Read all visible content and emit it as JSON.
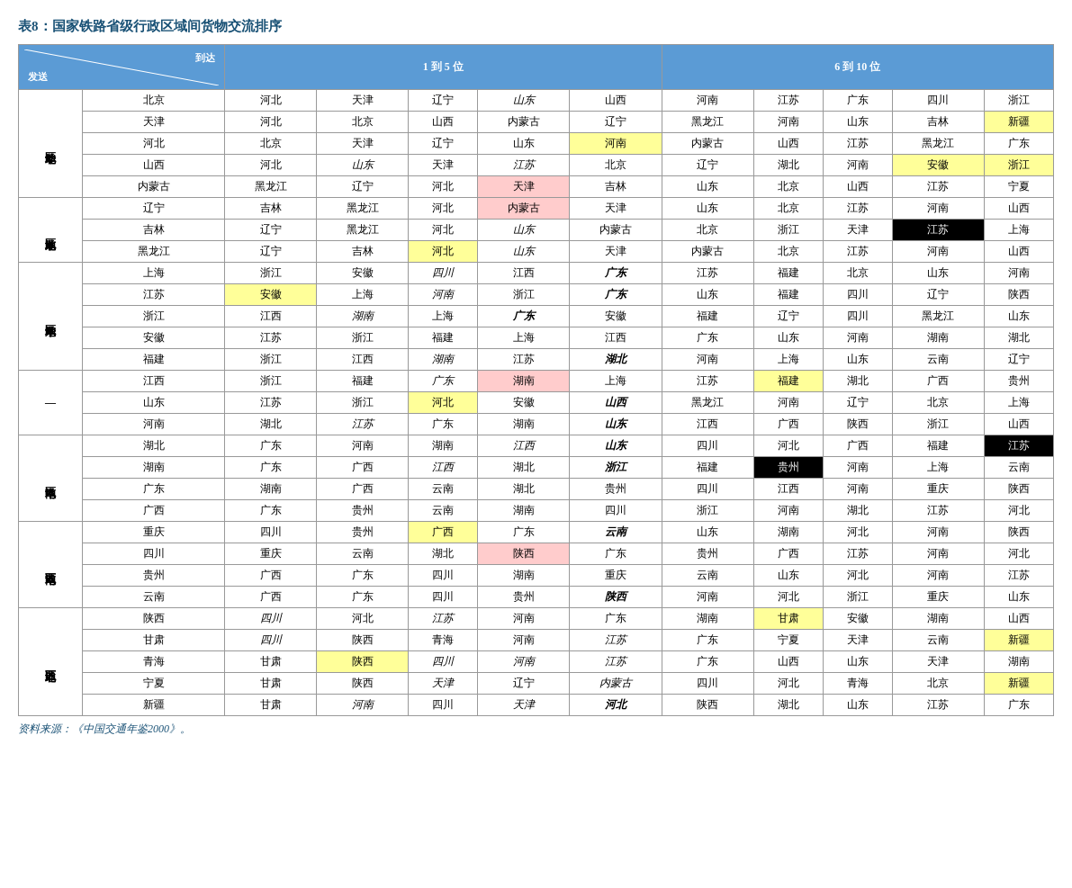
{
  "title": "表8：国家铁路省级行政区域间货物交流排序",
  "source": "资料来源：《中国交通年鉴2000》。",
  "header": {
    "diagonal_to": "到达",
    "diagonal_from": "发送",
    "col1_label": "1 到 5 位",
    "col2_label": "6 到 10 位"
  },
  "rows": [
    {
      "region": "华北地区",
      "city": "北京",
      "c1": "河北",
      "c2": "天津",
      "c3": "辽宁",
      "c4": "山东",
      "c5": "山西",
      "c6": "河南",
      "c7": "江苏",
      "c8": "广东",
      "c9": "四川",
      "c10": "浙江",
      "c3_style": "plain",
      "c4_style": "italic",
      "c5_style": "plain"
    },
    {
      "region": "",
      "city": "天津",
      "c1": "河北",
      "c2": "北京",
      "c3": "山西",
      "c4": "内蒙古",
      "c5": "辽宁",
      "c6": "黑龙江",
      "c7": "河南",
      "c8": "山东",
      "c9": "吉林",
      "c10": "新疆",
      "c3_style": "plain",
      "c4_style": "plain",
      "c10_style": "yellow"
    },
    {
      "region": "",
      "city": "河北",
      "c1": "北京",
      "c2": "天津",
      "c3": "辽宁",
      "c4": "山东",
      "c5": "河南",
      "c6": "内蒙古",
      "c7": "山西",
      "c8": "江苏",
      "c9": "黑龙江",
      "c10": "广东",
      "c3_style": "plain",
      "c5_style": "yellow",
      "c8_style": "plain"
    },
    {
      "region": "",
      "city": "山西",
      "c1": "河北",
      "c2": "山东",
      "c3": "天津",
      "c4": "江苏",
      "c5": "北京",
      "c6": "辽宁",
      "c7": "湖北",
      "c8": "河南",
      "c9": "安徽",
      "c10": "浙江",
      "c2_style": "italic",
      "c4_style": "italic",
      "c9_style": "yellow",
      "c10_style": "yellow"
    },
    {
      "region": "",
      "city": "内蒙古",
      "c1": "黑龙江",
      "c2": "辽宁",
      "c3": "河北",
      "c4": "天津",
      "c5": "吉林",
      "c6": "山东",
      "c7": "北京",
      "c8": "山西",
      "c9": "江苏",
      "c10": "宁夏",
      "c4_style": "pink"
    },
    {
      "region": "东北地区",
      "city": "辽宁",
      "c1": "吉林",
      "c2": "黑龙江",
      "c3": "河北",
      "c4": "内蒙古",
      "c5": "天津",
      "c6": "山东",
      "c7": "北京",
      "c8": "江苏",
      "c9": "河南",
      "c10": "山西",
      "c4_style": "pink"
    },
    {
      "region": "",
      "city": "吉林",
      "c1": "辽宁",
      "c2": "黑龙江",
      "c3": "河北",
      "c4": "山东",
      "c5": "内蒙古",
      "c6": "北京",
      "c7": "浙江",
      "c8": "天津",
      "c9": "江苏",
      "c10": "上海",
      "c4_style": "italic",
      "c9_style": "black"
    },
    {
      "region": "",
      "city": "黑龙江",
      "c1": "辽宁",
      "c2": "吉林",
      "c3": "河北",
      "c4": "山东",
      "c5": "天津",
      "c6": "内蒙古",
      "c7": "北京",
      "c8": "江苏",
      "c9": "河南",
      "c10": "山西",
      "c3_style": "yellow",
      "c4_style": "italic"
    },
    {
      "region": "华东地区",
      "city": "上海",
      "c1": "浙江",
      "c2": "安徽",
      "c3": "四川",
      "c4": "江西",
      "c5": "广东",
      "c6": "江苏",
      "c7": "福建",
      "c8": "北京",
      "c9": "山东",
      "c10": "河南",
      "c3_style": "italic",
      "c5_style": "italic-bold"
    },
    {
      "region": "",
      "city": "江苏",
      "c1": "安徽",
      "c2": "上海",
      "c3": "河南",
      "c4": "浙江",
      "c5": "广东",
      "c6": "山东",
      "c7": "福建",
      "c8": "四川",
      "c9": "辽宁",
      "c10": "陕西",
      "c1_style": "yellow",
      "c3_style": "italic",
      "c5_style": "italic-bold"
    },
    {
      "region": "",
      "city": "浙江",
      "c1": "江西",
      "c2": "湖南",
      "c3": "上海",
      "c4": "广东",
      "c5": "安徽",
      "c6": "福建",
      "c7": "辽宁",
      "c8": "四川",
      "c9": "黑龙江",
      "c10": "山东",
      "c2_style": "italic",
      "c4_style": "italic-bold"
    },
    {
      "region": "",
      "city": "安徽",
      "c1": "江苏",
      "c2": "浙江",
      "c3": "福建",
      "c4": "上海",
      "c5": "江西",
      "c6": "广东",
      "c7": "山东",
      "c8": "河南",
      "c9": "湖南",
      "c10": "湖北"
    },
    {
      "region": "",
      "city": "福建",
      "c1": "浙江",
      "c2": "江西",
      "c3": "湖南",
      "c4": "江苏",
      "c5": "湖北",
      "c6": "河南",
      "c7": "上海",
      "c8": "山东",
      "c9": "云南",
      "c10": "辽宁",
      "c3_style": "italic",
      "c5_style": "italic-bold"
    },
    {
      "region": "—",
      "city": "江西",
      "c1": "浙江",
      "c2": "福建",
      "c3": "广东",
      "c4": "湖南",
      "c5": "上海",
      "c6": "江苏",
      "c7": "福建",
      "c8": "湖北",
      "c9": "广西",
      "c10": "贵州",
      "c3_style": "italic",
      "c4_style": "pink",
      "c7_style": "yellow"
    },
    {
      "region": "",
      "city": "山东",
      "c1": "江苏",
      "c2": "浙江",
      "c3": "河北",
      "c4": "安徽",
      "c5": "山西",
      "c6": "黑龙江",
      "c7": "河南",
      "c8": "辽宁",
      "c9": "北京",
      "c10": "上海",
      "c3_style": "yellow",
      "c5_style": "italic-bold"
    },
    {
      "region": "",
      "city": "河南",
      "c1": "湖北",
      "c2": "江苏",
      "c3": "广东",
      "c4": "湖南",
      "c5": "山东",
      "c6": "江西",
      "c7": "广西",
      "c8": "陕西",
      "c9": "浙江",
      "c10": "山西",
      "c2_style": "italic",
      "c5_style": "italic-bold"
    },
    {
      "region": "中南地区",
      "city": "湖北",
      "c1": "广东",
      "c2": "河南",
      "c3": "湖南",
      "c4": "江西",
      "c5": "山东",
      "c6": "四川",
      "c7": "河北",
      "c8": "广西",
      "c9": "福建",
      "c10": "江苏",
      "c4_style": "italic",
      "c5_style": "italic-bold",
      "c10_style": "black"
    },
    {
      "region": "",
      "city": "湖南",
      "c1": "广东",
      "c2": "广西",
      "c3": "江西",
      "c4": "湖北",
      "c5": "浙江",
      "c6": "福建",
      "c7": "贵州",
      "c8": "河南",
      "c9": "上海",
      "c10": "云南",
      "c3_style": "italic",
      "c5_style": "italic-bold",
      "c7_style": "black"
    },
    {
      "region": "",
      "city": "广东",
      "c1": "湖南",
      "c2": "广西",
      "c3": "云南",
      "c4": "湖北",
      "c5": "贵州",
      "c6": "四川",
      "c7": "江西",
      "c8": "河南",
      "c9": "重庆",
      "c10": "陕西",
      "c9_style": "plain"
    },
    {
      "region": "",
      "city": "广西",
      "c1": "广东",
      "c2": "贵州",
      "c3": "云南",
      "c4": "湖南",
      "c5": "四川",
      "c6": "浙江",
      "c7": "河南",
      "c8": "湖北",
      "c9": "江苏",
      "c10": "河北"
    },
    {
      "region": "西南地区",
      "city": "重庆",
      "c1": "四川",
      "c2": "贵州",
      "c3": "广西",
      "c4": "广东",
      "c5": "云南",
      "c6": "山东",
      "c7": "湖南",
      "c8": "河北",
      "c9": "河南",
      "c10": "陕西",
      "c3_style": "yellow",
      "c5_style": "italic-bold"
    },
    {
      "region": "",
      "city": "四川",
      "c1": "重庆",
      "c2": "云南",
      "c3": "湖北",
      "c4": "陕西",
      "c5": "广东",
      "c6": "贵州",
      "c7": "广西",
      "c8": "江苏",
      "c9": "河南",
      "c10": "河北",
      "c4_style": "pink"
    },
    {
      "region": "",
      "city": "贵州",
      "c1": "广西",
      "c2": "广东",
      "c3": "四川",
      "c4": "湖南",
      "c5": "重庆",
      "c6": "云南",
      "c7": "山东",
      "c8": "河北",
      "c9": "河南",
      "c10": "江苏",
      "c6_style": "plain"
    },
    {
      "region": "",
      "city": "云南",
      "c1": "广西",
      "c2": "广东",
      "c3": "四川",
      "c4": "贵州",
      "c5": "陕西",
      "c6": "河南",
      "c7": "河北",
      "c8": "浙江",
      "c9": "重庆",
      "c10": "山东",
      "c5_style": "italic-bold"
    },
    {
      "region": "西北地区",
      "city": "陕西",
      "c1": "四川",
      "c2": "河北",
      "c3": "江苏",
      "c4": "河南",
      "c5": "广东",
      "c6": "湖南",
      "c7": "甘肃",
      "c8": "安徽",
      "c9": "湖南",
      "c10": "山西",
      "c1_style": "italic",
      "c3_style": "italic",
      "c7_style": "yellow"
    },
    {
      "region": "",
      "city": "甘肃",
      "c1": "四川",
      "c2": "陕西",
      "c3": "青海",
      "c4": "河南",
      "c5": "江苏",
      "c6": "广东",
      "c7": "宁夏",
      "c8": "天津",
      "c9": "云南",
      "c10": "新疆",
      "c1_style": "italic",
      "c5_style": "italic",
      "c10_style": "yellow"
    },
    {
      "region": "",
      "city": "青海",
      "c1": "甘肃",
      "c2": "陕西",
      "c3": "四川",
      "c4": "河南",
      "c5": "江苏",
      "c6": "广东",
      "c7": "山西",
      "c8": "山东",
      "c9": "天津",
      "c10": "湖南",
      "c2_style": "yellow",
      "c3_style": "italic",
      "c4_style": "italic",
      "c5_style": "italic"
    },
    {
      "region": "",
      "city": "宁夏",
      "c1": "甘肃",
      "c2": "陕西",
      "c3": "天津",
      "c4": "辽宁",
      "c5": "内蒙古",
      "c6": "四川",
      "c7": "河北",
      "c8": "青海",
      "c9": "北京",
      "c10": "新疆",
      "c3_style": "italic",
      "c5_style": "italic",
      "c8_style": "plain",
      "c10_style": "yellow"
    },
    {
      "region": "",
      "city": "新疆",
      "c1": "甘肃",
      "c2": "河南",
      "c3": "四川",
      "c4": "天津",
      "c5": "河北",
      "c6": "陕西",
      "c7": "湖北",
      "c8": "山东",
      "c9": "江苏",
      "c10": "广东",
      "c2_style": "italic",
      "c4_style": "italic",
      "c5_style": "italic-bold"
    }
  ]
}
